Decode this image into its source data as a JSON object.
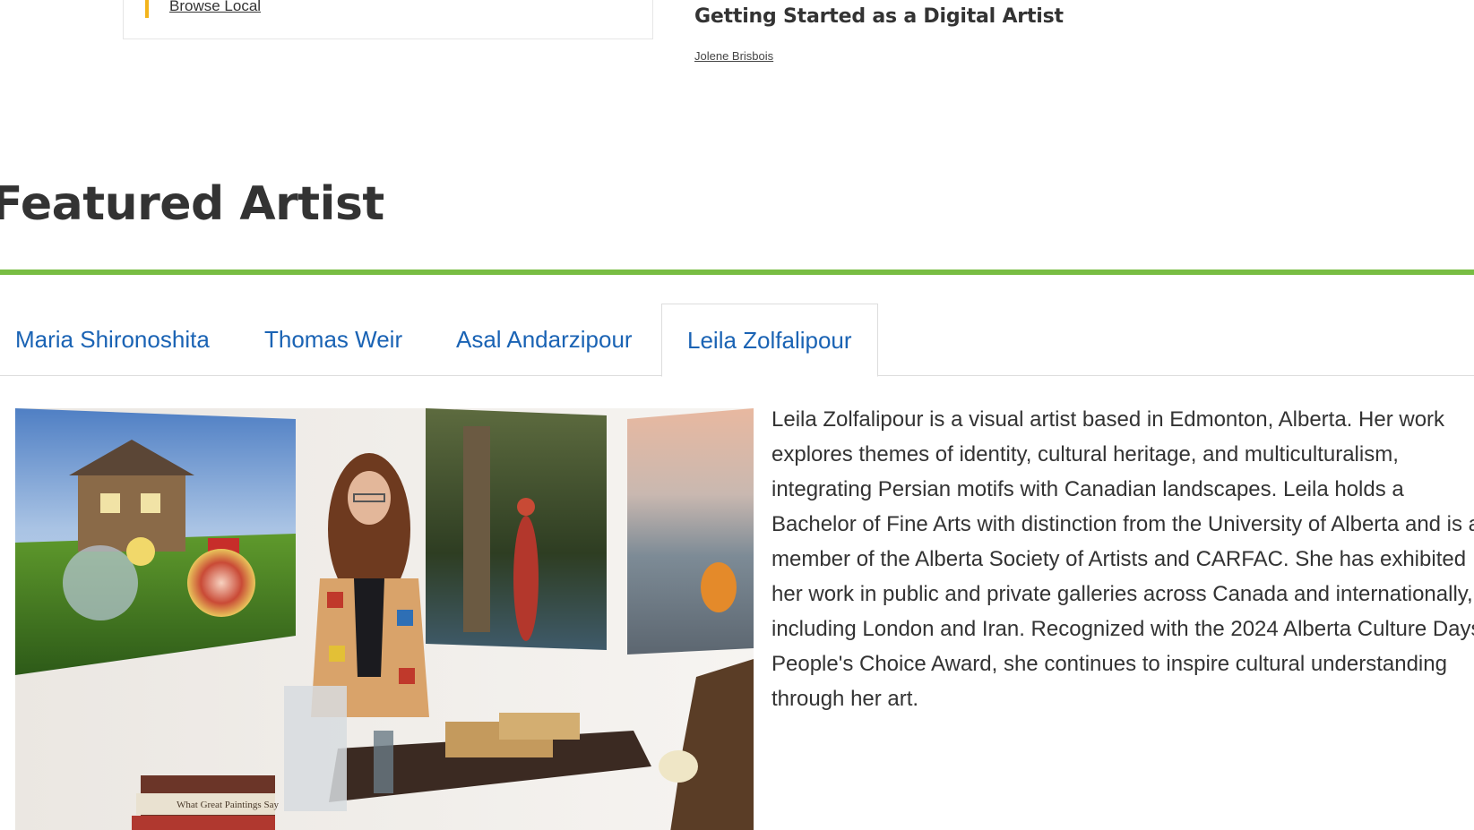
{
  "top_card": {
    "link_label": "Browse Local"
  },
  "article": {
    "title": "Getting Started as a Digital Artist",
    "author": "Jolene Brisbois"
  },
  "featured": {
    "heading": "Featured Artist",
    "tabs": [
      {
        "label": "Maria Shironoshita",
        "active": false
      },
      {
        "label": "Thomas Weir",
        "active": false
      },
      {
        "label": "Asal Andarzipour",
        "active": false
      },
      {
        "label": "Leila Zolfalipour",
        "active": true
      }
    ],
    "bio": "Leila Zolfalipour is a visual artist based in Edmonton, Alberta. Her work explores themes of identity, cultural heritage, and multiculturalism, integrating Persian motifs with Canadian landscapes. Leila holds a Bachelor of Fine Arts with distinction from the University of Alberta and is a member of the Alberta Society of Artists and CARFAC. She has exhibited her work in public and private galleries across Canada and internationally, including London and Iran. Recognized with the 2024 Alberta Culture Days People's Choice Award, she continues to inspire cultural understanding through her art.",
    "photo": {
      "book_title": "What Great Paintings Say"
    }
  },
  "colors": {
    "accent_green": "#78bd43",
    "link_blue": "#1a63b4",
    "card_accent": "#f3b41b"
  }
}
